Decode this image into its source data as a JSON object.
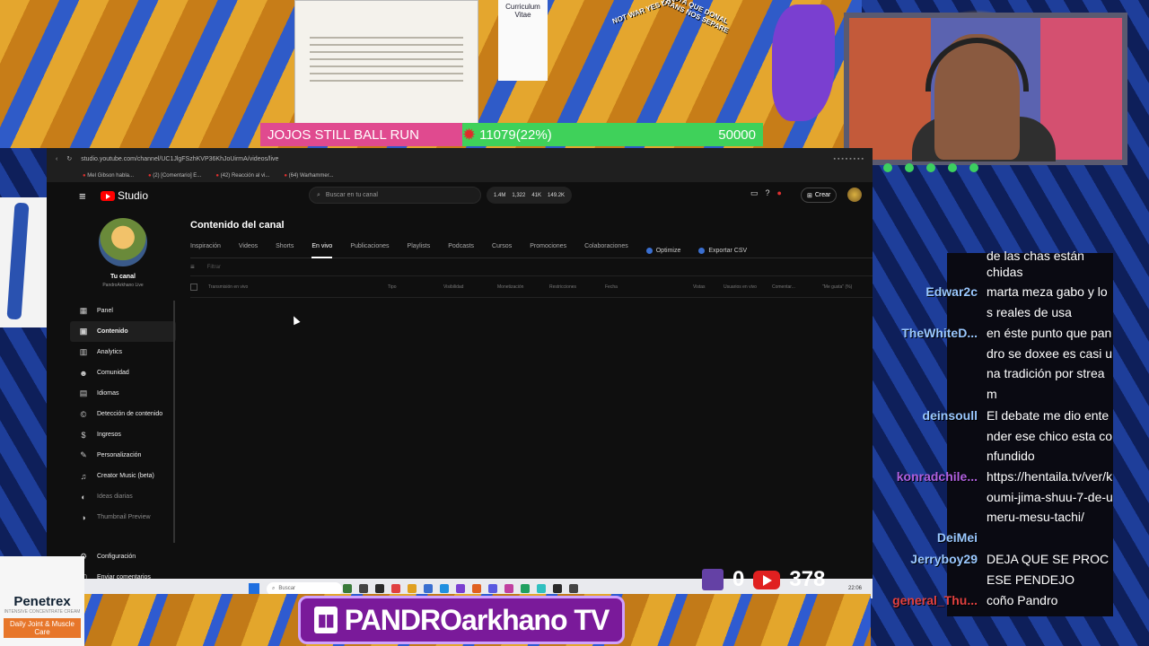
{
  "overlay": {
    "goal_label": "JOJOS STILL BALL RUN",
    "goal_progress": "11079(22%)",
    "goal_target": "50000",
    "goal_fraction": 0.22,
    "cv_title": "Curriculum Vitae",
    "meme_caption_left": "NOT WAR YES LOVE",
    "meme_caption_right": "HASTA QUE DONAL TRANS NOS SEPARE",
    "brand_name": "PANDROarkhano TV",
    "twitch_viewers": "0",
    "youtube_viewers": "378",
    "ad_brand": "Penetrex",
    "ad_tagline": "Daily Joint & Muscle Care",
    "ad_subtitle": "INTENSIVE CONCENTRATE CREAM"
  },
  "chat": [
    {
      "user": "",
      "msg": "de las chas están",
      "color": "#9ac8ff"
    },
    {
      "user": "",
      "msg": "chidas",
      "color": "#9ac8ff"
    },
    {
      "user": "Edwar2c",
      "msg": "marta meza gabo y los reales de usa",
      "color": "#9ac8ff"
    },
    {
      "user": "TheWhiteD...",
      "msg": "en éste punto que pandro se doxee es casi una tradición por stream",
      "color": "#9ac8ff"
    },
    {
      "user": "deinsoull",
      "msg": "El debate me dio entender ese chico esta confundido",
      "color": "#9ac8ff"
    },
    {
      "user": "konradchile...",
      "msg": "https://hentaila.tv/ver/koumi-jima-shuu-7-de-umeru-mesu-tachi/",
      "color": "#b060e0"
    },
    {
      "user": "DeiMei",
      "msg": "",
      "color": "#9ac8ff"
    },
    {
      "user": "Jerryboy29",
      "msg": "DEJA QUE SE PROCESE PENDEJO",
      "color": "#9ac8ff"
    },
    {
      "user": "general_Thu...",
      "msg": "coño Pandro",
      "color": "#e04040"
    }
  ],
  "browser": {
    "url": "studio.youtube.com/channel/UC1JlgFSzhKVP36KhJoUirmA/videos/live",
    "bookmarks": [
      "Mel Gibson habla...",
      "(2) [Comentario] E...",
      "(42) Reacción al vi...",
      "(64) Warhammer..."
    ]
  },
  "studio": {
    "logo_text": "Studio",
    "search_placeholder": "Buscar en tu canal",
    "stats": [
      "1.4M",
      "1,322",
      "41K",
      "149.2K"
    ],
    "create_label": "Crear",
    "channel_label": "Tu canal",
    "channel_handle": "PandroArkhano Live",
    "page_title": "Contenido del canal",
    "filter_placeholder": "Filtrar",
    "tabs": [
      {
        "label": "Inspiración"
      },
      {
        "label": "Videos"
      },
      {
        "label": "Shorts"
      },
      {
        "label": "En vivo",
        "active": true
      },
      {
        "label": "Publicaciones"
      },
      {
        "label": "Playlists"
      },
      {
        "label": "Podcasts"
      },
      {
        "label": "Cursos"
      },
      {
        "label": "Promociones"
      },
      {
        "label": "Colaboraciones"
      }
    ],
    "tab_actions": [
      "Optimize",
      "Exportar CSV"
    ],
    "columns": [
      "Transmisión en vivo",
      "Tipo",
      "Visibilidad",
      "Monetización",
      "Restricciones",
      "Fecha",
      "Vistas",
      "Usuarios en vivo",
      "Comentar...",
      "\"Me gusta\" (%)"
    ],
    "nav": [
      {
        "label": "Panel",
        "icon": "dashboard-icon",
        "glyph": "▦"
      },
      {
        "label": "Contenido",
        "icon": "content-icon",
        "glyph": "▣",
        "active": true
      },
      {
        "label": "Analytics",
        "icon": "analytics-icon",
        "glyph": "▥"
      },
      {
        "label": "Comunidad",
        "icon": "community-icon",
        "glyph": "☻"
      },
      {
        "label": "Idiomas",
        "icon": "subtitles-icon",
        "glyph": "▤"
      },
      {
        "label": "Detección de contenido",
        "icon": "copyright-icon",
        "glyph": "©"
      },
      {
        "label": "Ingresos",
        "icon": "monetization-icon",
        "glyph": "$"
      },
      {
        "label": "Personalización",
        "icon": "customization-icon",
        "glyph": "✎"
      },
      {
        "label": "Creator Music (beta)",
        "icon": "music-icon",
        "glyph": "♫"
      },
      {
        "label": "Ideas diarias",
        "icon": "ideas-icon",
        "glyph": "◐",
        "dim": true
      },
      {
        "label": "Thumbnail Preview",
        "icon": "thumbnail-icon",
        "glyph": "◑",
        "dim": true
      }
    ],
    "nav_bottom": [
      {
        "label": "Configuración",
        "icon": "settings-icon",
        "glyph": "⚙"
      },
      {
        "label": "Enviar comentarios",
        "icon": "feedback-icon",
        "glyph": "▢"
      }
    ]
  },
  "taskbar": {
    "search_placeholder": "Buscar",
    "clock": "22:06"
  }
}
